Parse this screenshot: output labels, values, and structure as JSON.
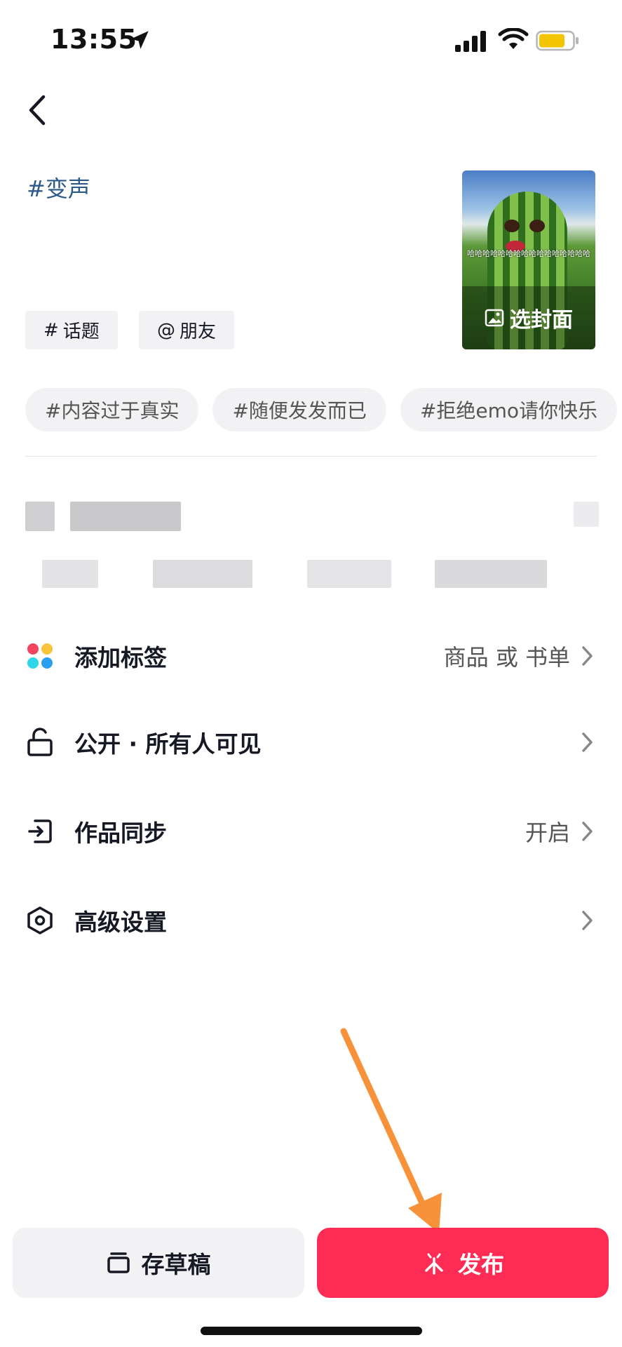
{
  "status_bar": {
    "time": "13:55",
    "location_icon": "location-arrow-icon",
    "signal_icon": "cellular-signal-icon",
    "wifi_icon": "wifi-icon",
    "battery_icon": "battery-icon",
    "battery_color": "#f5c400"
  },
  "header": {
    "back_icon": "chevron-left-icon"
  },
  "caption": {
    "text": "#变声"
  },
  "cover": {
    "subtitle": "哈哈哈哈哈哈哈哈哈哈哈哈哈哈哈哈",
    "label": "选封面",
    "icon": "image-icon"
  },
  "quick_insert": {
    "topic_symbol": "#",
    "topic_label": "话题",
    "mention_symbol": "@",
    "mention_label": "朋友"
  },
  "hashtags": [
    "#内容过于真实",
    "#随便发发而已",
    "#拒绝emo请你快乐"
  ],
  "settings": [
    {
      "label": "添加标签",
      "value": "商品 或 书单",
      "icon": "colorful-dots-icon"
    },
    {
      "label": "公开 · 所有人可见",
      "value": "",
      "icon": "unlock-icon"
    },
    {
      "label": "作品同步",
      "value": "开启",
      "icon": "sync-exit-icon"
    },
    {
      "label": "高级设置",
      "value": "",
      "icon": "hexagon-settings-icon"
    }
  ],
  "bottom": {
    "draft_label": "存草稿",
    "publish_label": "发布"
  },
  "colors": {
    "accent": "#fe2c55",
    "link": "#2a5a8a",
    "annotation_arrow": "#f7923a"
  }
}
